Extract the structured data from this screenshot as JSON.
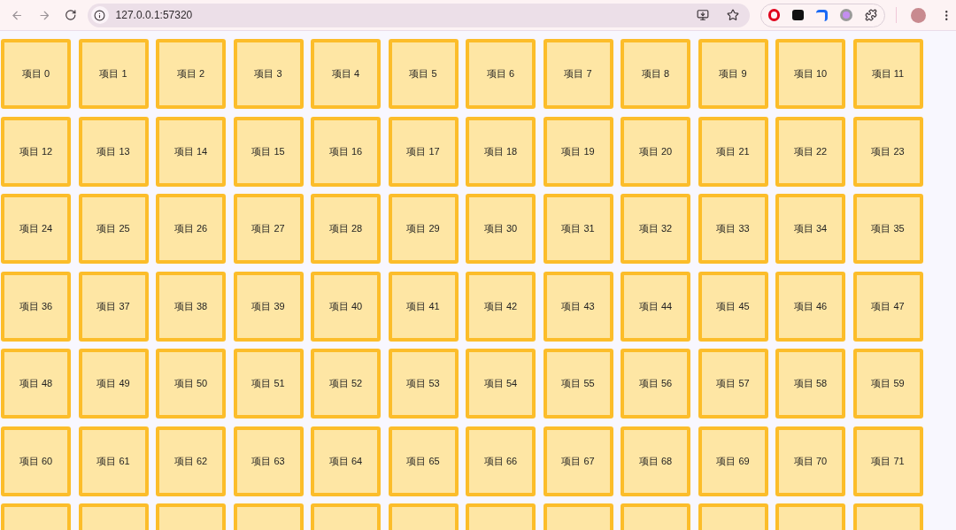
{
  "browser": {
    "address": "127.0.0.1:57320",
    "back_disabled": true,
    "forward_disabled": true
  },
  "grid": {
    "items": [
      {
        "label": "项目 0"
      },
      {
        "label": "项目 1"
      },
      {
        "label": "项目 2"
      },
      {
        "label": "项目 3"
      },
      {
        "label": "项目 4"
      },
      {
        "label": "项目 5"
      },
      {
        "label": "项目 6"
      },
      {
        "label": "项目 7"
      },
      {
        "label": "项目 8"
      },
      {
        "label": "项目 9"
      },
      {
        "label": "项目 10"
      },
      {
        "label": "项目 11"
      },
      {
        "label": "项目 12"
      },
      {
        "label": "项目 13"
      },
      {
        "label": "项目 14"
      },
      {
        "label": "项目 15"
      },
      {
        "label": "项目 16"
      },
      {
        "label": "项目 17"
      },
      {
        "label": "项目 18"
      },
      {
        "label": "项目 19"
      },
      {
        "label": "项目 20"
      },
      {
        "label": "项目 21"
      },
      {
        "label": "项目 22"
      },
      {
        "label": "项目 23"
      },
      {
        "label": "项目 24"
      },
      {
        "label": "项目 25"
      },
      {
        "label": "项目 26"
      },
      {
        "label": "项目 27"
      },
      {
        "label": "项目 28"
      },
      {
        "label": "项目 29"
      },
      {
        "label": "项目 30"
      },
      {
        "label": "项目 31"
      },
      {
        "label": "项目 32"
      },
      {
        "label": "项目 33"
      },
      {
        "label": "项目 34"
      },
      {
        "label": "项目 35"
      },
      {
        "label": "项目 36"
      },
      {
        "label": "项目 37"
      },
      {
        "label": "项目 38"
      },
      {
        "label": "项目 39"
      },
      {
        "label": "项目 40"
      },
      {
        "label": "项目 41"
      },
      {
        "label": "项目 42"
      },
      {
        "label": "项目 43"
      },
      {
        "label": "项目 44"
      },
      {
        "label": "项目 45"
      },
      {
        "label": "项目 46"
      },
      {
        "label": "项目 47"
      },
      {
        "label": "项目 48"
      },
      {
        "label": "项目 49"
      },
      {
        "label": "项目 50"
      },
      {
        "label": "项目 51"
      },
      {
        "label": "项目 52"
      },
      {
        "label": "项目 53"
      },
      {
        "label": "项目 54"
      },
      {
        "label": "项目 55"
      },
      {
        "label": "项目 56"
      },
      {
        "label": "项目 57"
      },
      {
        "label": "项目 58"
      },
      {
        "label": "项目 59"
      },
      {
        "label": "项目 60"
      },
      {
        "label": "项目 61"
      },
      {
        "label": "项目 62"
      },
      {
        "label": "项目 63"
      },
      {
        "label": "项目 64"
      },
      {
        "label": "项目 65"
      },
      {
        "label": "项目 66"
      },
      {
        "label": "项目 67"
      },
      {
        "label": "项目 68"
      },
      {
        "label": "项目 69"
      },
      {
        "label": "项目 70"
      },
      {
        "label": "项目 71"
      },
      {
        "kind": "blank"
      },
      {
        "kind": "blank"
      },
      {
        "kind": "blank"
      },
      {
        "kind": "blank"
      },
      {
        "kind": "blank"
      },
      {
        "kind": "blank"
      },
      {
        "kind": "blank"
      },
      {
        "kind": "blank"
      },
      {
        "kind": "blank"
      },
      {
        "kind": "blank"
      },
      {
        "kind": "blank"
      },
      {
        "kind": "blank"
      }
    ]
  }
}
